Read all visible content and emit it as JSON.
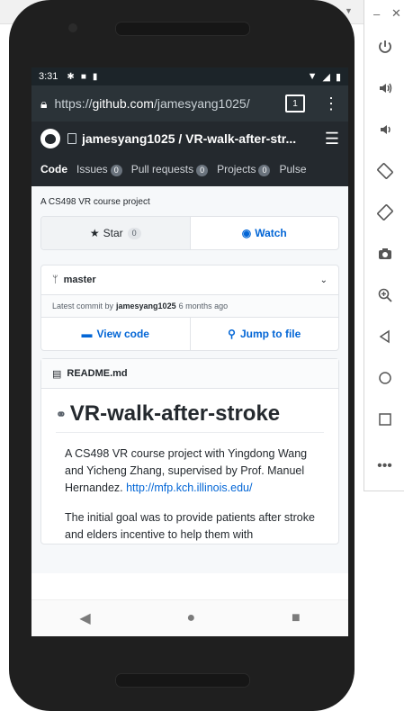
{
  "status_bar": {
    "time": "3:31"
  },
  "browser": {
    "url_scheme": "https://",
    "url_host": "github.com",
    "url_path": "/jamesyang1025/",
    "tab_count": "1"
  },
  "repo": {
    "path": "jamesyang1025 / VR-walk-after-str...",
    "nav": [
      {
        "label": "Code",
        "count": ""
      },
      {
        "label": "Issues",
        "count": "0"
      },
      {
        "label": "Pull requests",
        "count": "0"
      },
      {
        "label": "Projects",
        "count": "0"
      },
      {
        "label": "Pulse",
        "count": ""
      }
    ],
    "description": "A CS498 VR course project",
    "star_label": "Star",
    "star_count": "0",
    "watch_label": "Watch",
    "branch": "master",
    "commit_prefix": "Latest commit by",
    "commit_author": "jamesyang1025",
    "commit_time": "6 months ago",
    "view_code": "View code",
    "jump_to_file": "Jump to file"
  },
  "readme": {
    "file_name": "README.md",
    "title": "VR-walk-after-stroke",
    "para1_text": "A CS498 VR course project with Yingdong Wang and Yicheng Zhang, supervised by Prof. Manuel Hernandez.",
    "para1_link": "http://mfp.kch.illinois.edu/",
    "para2_text": "The initial goal was to provide patients after stroke and elders incentive to help them with"
  },
  "icons": {
    "side_controls": [
      "power-icon",
      "volume-up-icon",
      "volume-down-icon",
      "rotate-left-icon",
      "rotate-right-icon",
      "camera-icon",
      "zoom-icon",
      "back-icon",
      "home-icon",
      "overview-icon",
      "more-icon"
    ]
  }
}
